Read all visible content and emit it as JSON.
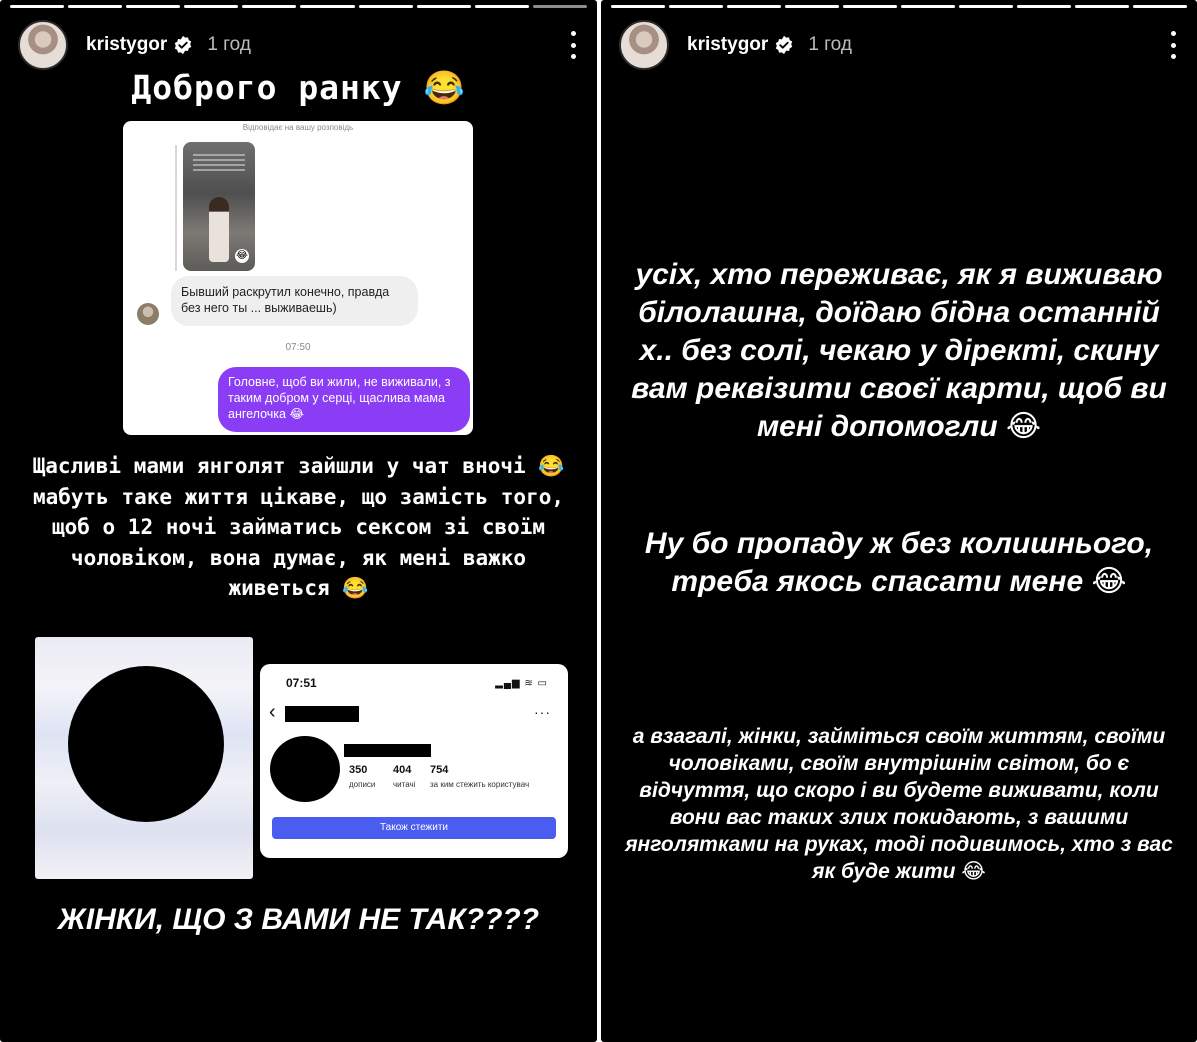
{
  "left_story": {
    "progress_segments": [
      1,
      1,
      1,
      1,
      1,
      1,
      1,
      1,
      1,
      0
    ],
    "username": "kristygor",
    "time": "1 год",
    "greeting": "Доброго ранку 😂",
    "chat": {
      "reply_hint": "Відповідає на вашу розповідь",
      "incoming_message": "Бывший раскрутил конечно, правда без него ты ... выживаешь)",
      "time": "07:50",
      "outgoing_message": "Головне, щоб ви жили, не виживали, з таким добром у серці, щаслива мама ангелочка 😂"
    },
    "body_text": "Щасливі мами янголят зайшли у чат вночі 😂мабуть таке життя цікаве, що замість того, щоб о 12 ночі займатись сексом зі своїм чоловіком, вона думає, як мені важко живеться 😂",
    "profile": {
      "time": "07:51",
      "status_icons": "▂▄▆ ≋ ▭",
      "back": "‹",
      "menu": "···",
      "stats": [
        {
          "number": "350",
          "label": "дописи"
        },
        {
          "number": "404",
          "label": "читачі"
        },
        {
          "number": "754",
          "label": "за ким стежить користувач"
        }
      ],
      "follow_label": "Також стежити"
    },
    "caps_text": "ЖІНКИ, ЩО З ВАМИ НЕ ТАК????"
  },
  "right_story": {
    "progress_segments": [
      1,
      1,
      1,
      1,
      1,
      1,
      1,
      1,
      1,
      1
    ],
    "username": "kristygor",
    "time": "1 год",
    "block1": "усіх, хто переживає, як я виживаю білолашна, доїдаю бідна останній х.. без солі, чекаю у діректі, скину вам реквізити своєї карти, щоб ви мені допомогли 😂",
    "block2": "Ну бо пропаду ж без колишнього, треба якось спасати мене 😂",
    "block3": "а взагалі, жінки, займіться своїм життям, своїми чоловіками, своїм внутрішнім світом, бо є відчуття, що скоро і ви будете виживати, коли вони вас таких злих покидають, з вашими янголятками на руках, тоді подивимось, хто з вас як буде жити 😂"
  }
}
